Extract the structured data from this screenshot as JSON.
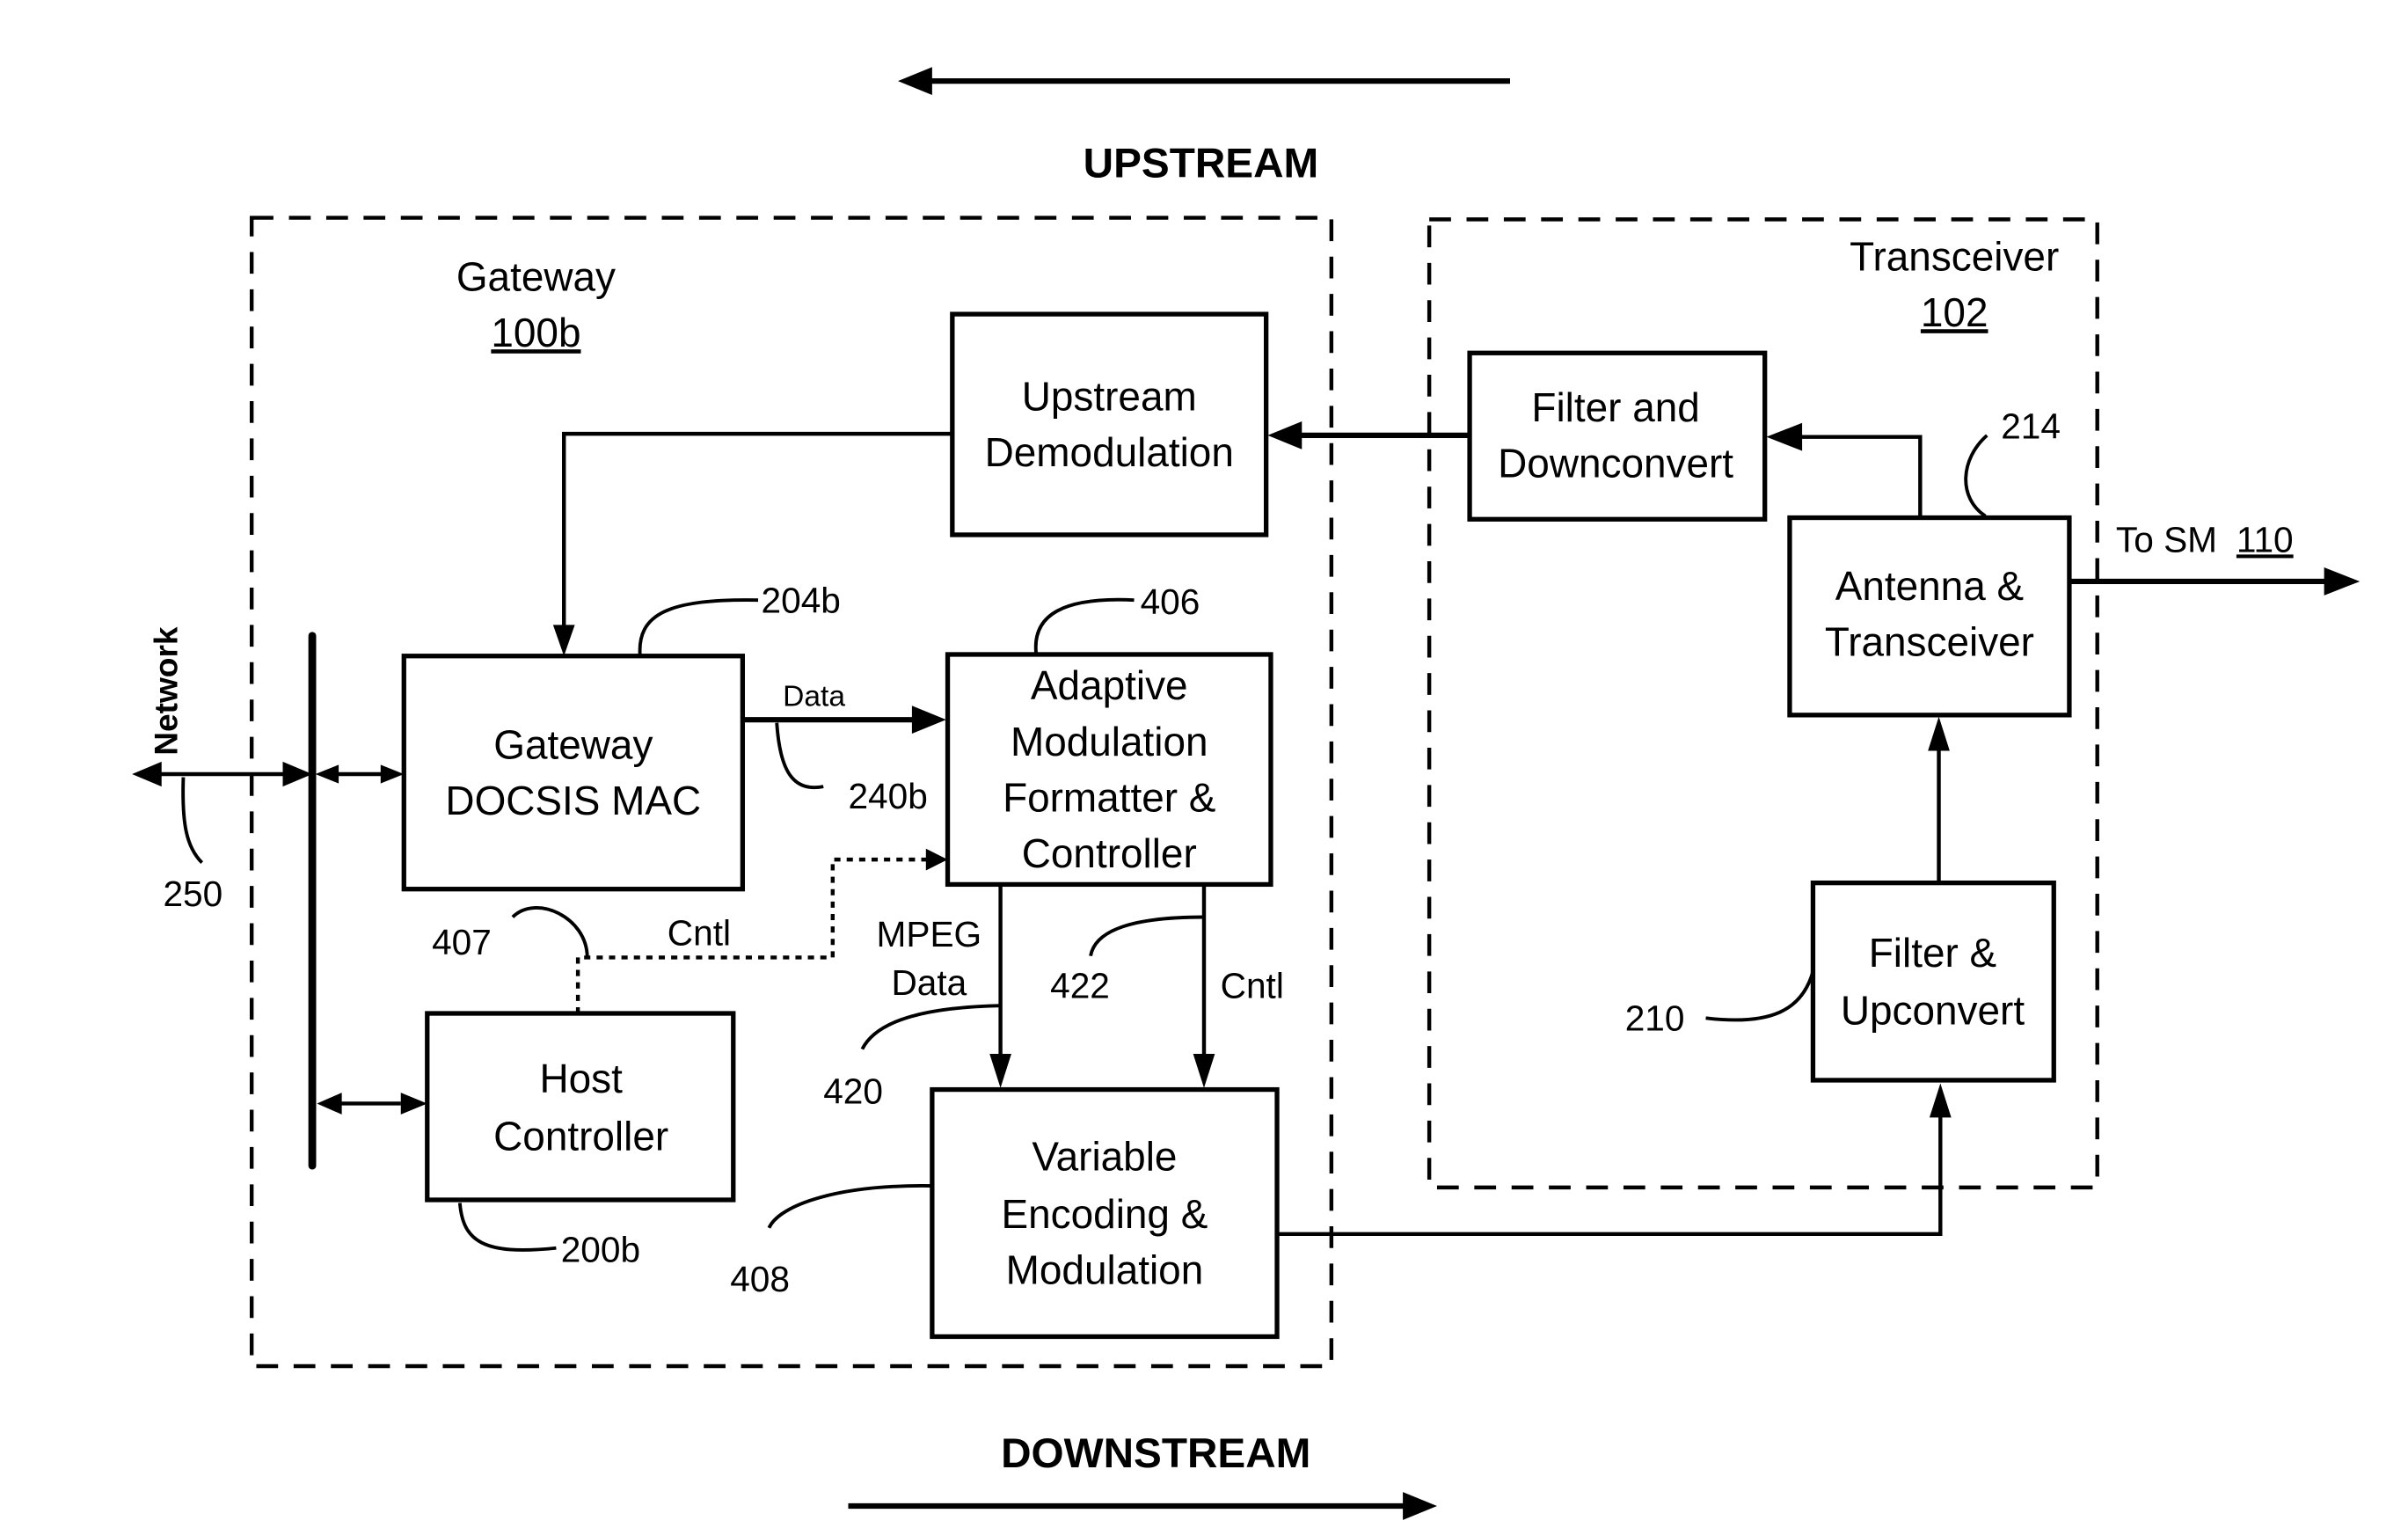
{
  "directions": {
    "upstream": "UPSTREAM",
    "downstream": "DOWNSTREAM"
  },
  "groups": {
    "gateway": {
      "title": "Gateway",
      "ref": "100b"
    },
    "transceiver": {
      "title": "Transceiver",
      "ref": "102"
    }
  },
  "blocks": {
    "upstream_demod": {
      "line1": "Upstream",
      "line2": "Demodulation"
    },
    "docsis_mac": {
      "line1": "Gateway",
      "line2": "DOCSIS MAC"
    },
    "adaptive_mod": {
      "line1": "Adaptive",
      "line2": "Modulation",
      "line3": "Formatter &",
      "line4": "Controller"
    },
    "host_controller": {
      "line1": "Host",
      "line2": "Controller"
    },
    "variable_enc": {
      "line1": "Variable",
      "line2": "Encoding &",
      "line3": "Modulation"
    },
    "filter_down": {
      "line1": "Filter and",
      "line2": "Downconvert"
    },
    "antenna": {
      "line1": "Antenna &",
      "line2": "Transceiver"
    },
    "filter_up": {
      "line1": "Filter &",
      "line2": "Upconvert"
    }
  },
  "signals": {
    "data": "Data",
    "cntl_dotted": "Cntl",
    "mpeg_line1": "MPEG",
    "mpeg_line2": "Data",
    "cntl_down": "Cntl",
    "network": "Network",
    "to_sm_prefix": "To SM",
    "to_sm_ref": "110"
  },
  "refs": {
    "r204b": "204b",
    "r406": "406",
    "r240b": "240b",
    "r250": "250",
    "r407": "407",
    "r422": "422",
    "r420": "420",
    "r200b": "200b",
    "r408": "408",
    "r214": "214",
    "r210": "210"
  }
}
